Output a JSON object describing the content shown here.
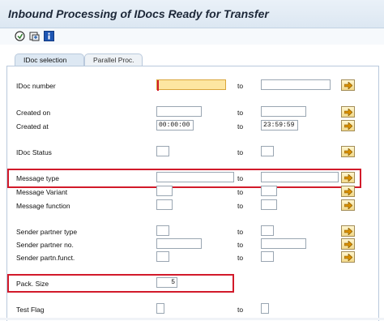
{
  "window": {
    "title": "Inbound Processing of IDocs Ready for Transfer"
  },
  "toolbar": {
    "icons": [
      "execute-icon",
      "save-variant-icon",
      "info-icon"
    ]
  },
  "tabs": [
    {
      "label": "IDoc selection",
      "active": true
    },
    {
      "label": "Parallel Proc.",
      "active": false
    }
  ],
  "range_separator": "to",
  "fields": {
    "idoc_number": {
      "label": "IDoc number",
      "from": "",
      "to": ""
    },
    "created_on": {
      "label": "Created on",
      "from": "",
      "to": ""
    },
    "created_at": {
      "label": "Created at",
      "from": "00:00:00",
      "to": "23:59:59"
    },
    "idoc_status": {
      "label": "IDoc Status",
      "from": "",
      "to": ""
    },
    "message_type": {
      "label": "Message type",
      "from": "",
      "to": ""
    },
    "message_variant": {
      "label": "Message Variant",
      "from": "",
      "to": ""
    },
    "message_function": {
      "label": "Message function",
      "from": "",
      "to": ""
    },
    "sender_partner_type": {
      "label": "Sender partner type",
      "from": "",
      "to": ""
    },
    "sender_partner_no": {
      "label": "Sender partner no.",
      "from": "",
      "to": ""
    },
    "sender_partn_funct": {
      "label": "Sender partn.funct.",
      "from": "",
      "to": ""
    },
    "pack_size": {
      "label": "Pack. Size",
      "value": "5"
    },
    "test_flag": {
      "label": "Test Flag",
      "from": "",
      "to": ""
    }
  },
  "colors": {
    "highlight": "#d21a2a",
    "focused_input": "#fde6a1",
    "multi_select_button": "#f3d98a"
  }
}
